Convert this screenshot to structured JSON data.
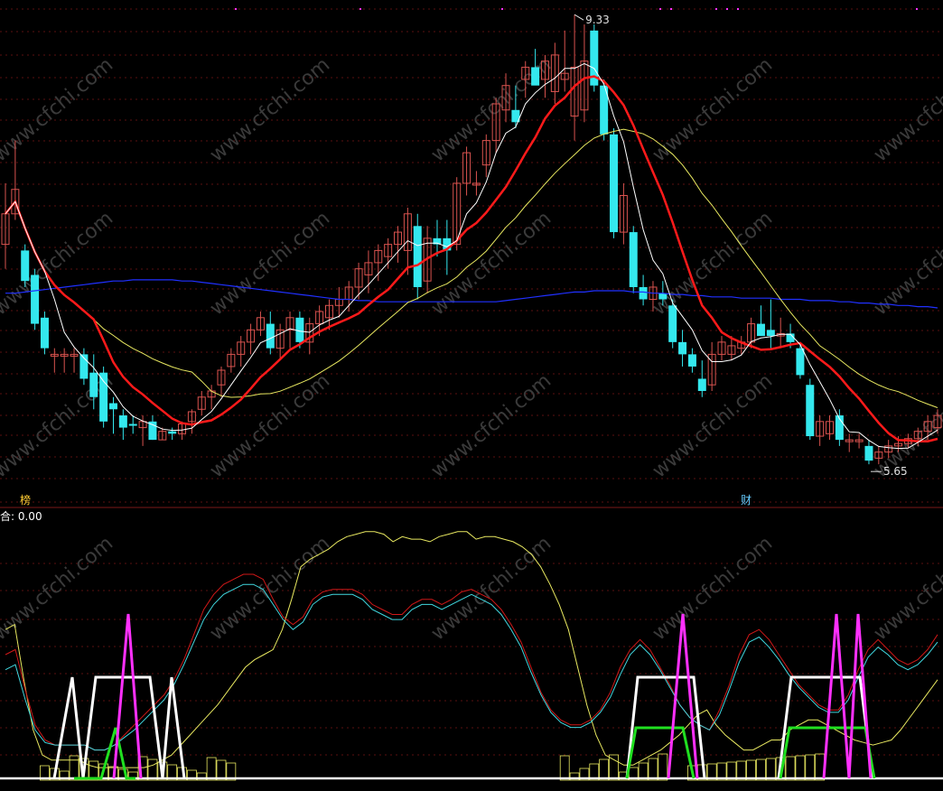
{
  "colors": {
    "background": "#000000",
    "grid": "#5a1010",
    "up": "#d9534f",
    "down": "#34e8ee",
    "ma5": "#ffffff",
    "ma10": "#ff1a1a",
    "ma20": "#e8e860",
    "ma60": "#2030ff",
    "ind_yellow": "#e8e860",
    "ind_red": "#d01818",
    "ind_cyan": "#40d8e0",
    "sig_white": "#ffffff",
    "sig_green": "#20e020",
    "sig_magenta": "#ff30ff",
    "bottom_bars": "#e8e860",
    "price_label": "#e0e0e0"
  },
  "watermark": "www.cfchi.com",
  "chart_data": {
    "type": "candlestick",
    "price_high_label": "9.33",
    "price_low_label": "5.65",
    "annotation_left": "榜",
    "annotation_right": "财",
    "indicator_header": "合: 0.00",
    "ylim": [
      5.4,
      9.45
    ],
    "candles": [
      {
        "o": 7.45,
        "h": 7.95,
        "l": 7.25,
        "c": 7.7
      },
      {
        "o": 7.7,
        "h": 8.3,
        "l": 7.65,
        "c": 7.9
      },
      {
        "o": 7.4,
        "h": 7.45,
        "l": 7.1,
        "c": 7.15
      },
      {
        "o": 7.2,
        "h": 7.25,
        "l": 6.75,
        "c": 6.8
      },
      {
        "o": 6.85,
        "h": 6.9,
        "l": 6.55,
        "c": 6.6
      },
      {
        "o": 6.55,
        "h": 6.6,
        "l": 6.4,
        "c": 6.55
      },
      {
        "o": 6.55,
        "h": 6.6,
        "l": 6.4,
        "c": 6.55
      },
      {
        "o": 6.55,
        "h": 6.6,
        "l": 6.4,
        "c": 6.55
      },
      {
        "o": 6.55,
        "h": 6.6,
        "l": 6.3,
        "c": 6.35
      },
      {
        "o": 6.4,
        "h": 6.55,
        "l": 6.1,
        "c": 6.2
      },
      {
        "o": 6.4,
        "h": 6.45,
        "l": 5.95,
        "c": 6.0
      },
      {
        "o": 6.15,
        "h": 6.2,
        "l": 5.9,
        "c": 6.1
      },
      {
        "o": 6.05,
        "h": 6.1,
        "l": 5.85,
        "c": 5.95
      },
      {
        "o": 5.98,
        "h": 6.05,
        "l": 5.9,
        "c": 5.97
      },
      {
        "o": 5.95,
        "h": 6.05,
        "l": 5.8,
        "c": 6.0
      },
      {
        "o": 6.0,
        "h": 6.05,
        "l": 5.85,
        "c": 5.85
      },
      {
        "o": 5.85,
        "h": 5.95,
        "l": 5.85,
        "c": 5.92
      },
      {
        "o": 5.92,
        "h": 5.95,
        "l": 5.85,
        "c": 5.9
      },
      {
        "o": 5.9,
        "h": 6.0,
        "l": 5.85,
        "c": 5.98
      },
      {
        "o": 6.0,
        "h": 6.1,
        "l": 5.9,
        "c": 6.08
      },
      {
        "o": 6.1,
        "h": 6.25,
        "l": 6.05,
        "c": 6.2
      },
      {
        "o": 6.2,
        "h": 6.3,
        "l": 6.1,
        "c": 6.25
      },
      {
        "o": 6.3,
        "h": 6.45,
        "l": 6.2,
        "c": 6.42
      },
      {
        "o": 6.45,
        "h": 6.6,
        "l": 6.4,
        "c": 6.55
      },
      {
        "o": 6.55,
        "h": 6.7,
        "l": 6.45,
        "c": 6.65
      },
      {
        "o": 6.65,
        "h": 6.8,
        "l": 6.55,
        "c": 6.75
      },
      {
        "o": 6.75,
        "h": 6.9,
        "l": 6.7,
        "c": 6.85
      },
      {
        "o": 6.8,
        "h": 6.9,
        "l": 6.55,
        "c": 6.6
      },
      {
        "o": 6.6,
        "h": 6.8,
        "l": 6.5,
        "c": 6.75
      },
      {
        "o": 6.75,
        "h": 6.9,
        "l": 6.6,
        "c": 6.85
      },
      {
        "o": 6.85,
        "h": 6.9,
        "l": 6.6,
        "c": 6.65
      },
      {
        "o": 6.65,
        "h": 6.85,
        "l": 6.55,
        "c": 6.8
      },
      {
        "o": 6.8,
        "h": 6.95,
        "l": 6.7,
        "c": 6.9
      },
      {
        "o": 6.85,
        "h": 7.0,
        "l": 6.75,
        "c": 6.95
      },
      {
        "o": 6.95,
        "h": 7.1,
        "l": 6.85,
        "c": 7.0
      },
      {
        "o": 7.0,
        "h": 7.15,
        "l": 6.9,
        "c": 7.1
      },
      {
        "o": 7.1,
        "h": 7.3,
        "l": 7.0,
        "c": 7.25
      },
      {
        "o": 7.2,
        "h": 7.4,
        "l": 7.05,
        "c": 7.3
      },
      {
        "o": 7.3,
        "h": 7.45,
        "l": 7.15,
        "c": 7.4
      },
      {
        "o": 7.35,
        "h": 7.5,
        "l": 7.25,
        "c": 7.45
      },
      {
        "o": 7.45,
        "h": 7.6,
        "l": 7.3,
        "c": 7.55
      },
      {
        "o": 7.4,
        "h": 7.75,
        "l": 7.2,
        "c": 7.7
      },
      {
        "o": 7.6,
        "h": 7.7,
        "l": 7.0,
        "c": 7.1
      },
      {
        "o": 7.15,
        "h": 7.6,
        "l": 7.05,
        "c": 7.5
      },
      {
        "o": 7.5,
        "h": 7.65,
        "l": 7.35,
        "c": 7.45
      },
      {
        "o": 7.5,
        "h": 7.65,
        "l": 7.2,
        "c": 7.4
      },
      {
        "o": 7.45,
        "h": 8.0,
        "l": 7.4,
        "c": 7.95
      },
      {
        "o": 7.95,
        "h": 8.25,
        "l": 7.85,
        "c": 8.2
      },
      {
        "o": 7.95,
        "h": 8.05,
        "l": 7.85,
        "c": 7.95
      },
      {
        "o": 8.1,
        "h": 8.35,
        "l": 8.0,
        "c": 8.3
      },
      {
        "o": 8.3,
        "h": 8.65,
        "l": 8.2,
        "c": 8.6
      },
      {
        "o": 8.55,
        "h": 8.85,
        "l": 8.45,
        "c": 8.75
      },
      {
        "o": 8.55,
        "h": 8.75,
        "l": 8.4,
        "c": 8.45
      },
      {
        "o": 8.8,
        "h": 8.95,
        "l": 8.65,
        "c": 8.9
      },
      {
        "o": 8.9,
        "h": 9.05,
        "l": 8.8,
        "c": 8.75
      },
      {
        "o": 8.8,
        "h": 9.0,
        "l": 8.65,
        "c": 8.95
      },
      {
        "o": 8.7,
        "h": 9.1,
        "l": 8.6,
        "c": 9.0
      },
      {
        "o": 8.8,
        "h": 9.2,
        "l": 8.7,
        "c": 8.85
      },
      {
        "o": 8.5,
        "h": 9.33,
        "l": 8.3,
        "c": 8.9
      },
      {
        "o": 8.55,
        "h": 9.25,
        "l": 8.45,
        "c": 8.95
      },
      {
        "o": 9.2,
        "h": 9.25,
        "l": 8.7,
        "c": 8.75
      },
      {
        "o": 8.75,
        "h": 8.8,
        "l": 8.3,
        "c": 8.35
      },
      {
        "o": 8.35,
        "h": 8.4,
        "l": 7.5,
        "c": 7.55
      },
      {
        "o": 7.55,
        "h": 7.95,
        "l": 7.45,
        "c": 7.85
      },
      {
        "o": 7.55,
        "h": 7.6,
        "l": 7.05,
        "c": 7.1
      },
      {
        "o": 7.1,
        "h": 7.2,
        "l": 6.95,
        "c": 7.0
      },
      {
        "o": 7.0,
        "h": 7.15,
        "l": 6.9,
        "c": 7.1
      },
      {
        "o": 7.05,
        "h": 7.15,
        "l": 6.95,
        "c": 7.0
      },
      {
        "o": 6.95,
        "h": 7.0,
        "l": 6.6,
        "c": 6.65
      },
      {
        "o": 6.65,
        "h": 6.75,
        "l": 6.45,
        "c": 6.55
      },
      {
        "o": 6.55,
        "h": 6.6,
        "l": 6.4,
        "c": 6.45
      },
      {
        "o": 6.35,
        "h": 6.5,
        "l": 6.2,
        "c": 6.25
      },
      {
        "o": 6.3,
        "h": 6.65,
        "l": 6.25,
        "c": 6.55
      },
      {
        "o": 6.55,
        "h": 6.7,
        "l": 6.5,
        "c": 6.65
      },
      {
        "o": 6.55,
        "h": 6.7,
        "l": 6.5,
        "c": 6.62
      },
      {
        "o": 6.6,
        "h": 6.7,
        "l": 6.55,
        "c": 6.65
      },
      {
        "o": 6.65,
        "h": 6.85,
        "l": 6.6,
        "c": 6.8
      },
      {
        "o": 6.8,
        "h": 6.95,
        "l": 6.7,
        "c": 6.7
      },
      {
        "o": 6.75,
        "h": 7.0,
        "l": 6.6,
        "c": 6.7
      },
      {
        "o": 6.7,
        "h": 6.85,
        "l": 6.6,
        "c": 6.72
      },
      {
        "o": 6.72,
        "h": 6.8,
        "l": 6.6,
        "c": 6.65
      },
      {
        "o": 6.6,
        "h": 6.65,
        "l": 6.35,
        "c": 6.38
      },
      {
        "o": 6.3,
        "h": 6.35,
        "l": 5.85,
        "c": 5.88
      },
      {
        "o": 5.88,
        "h": 6.05,
        "l": 5.8,
        "c": 6.0
      },
      {
        "o": 5.9,
        "h": 6.05,
        "l": 5.85,
        "c": 6.0
      },
      {
        "o": 6.05,
        "h": 6.1,
        "l": 5.8,
        "c": 5.85
      },
      {
        "o": 5.85,
        "h": 5.9,
        "l": 5.75,
        "c": 5.85
      },
      {
        "o": 5.85,
        "h": 5.9,
        "l": 5.78,
        "c": 5.85
      },
      {
        "o": 5.8,
        "h": 5.85,
        "l": 5.65,
        "c": 5.68
      },
      {
        "o": 5.7,
        "h": 5.8,
        "l": 5.65,
        "c": 5.75
      },
      {
        "o": 5.75,
        "h": 5.85,
        "l": 5.7,
        "c": 5.8
      },
      {
        "o": 5.8,
        "h": 5.88,
        "l": 5.75,
        "c": 5.82
      },
      {
        "o": 5.82,
        "h": 5.9,
        "l": 5.78,
        "c": 5.86
      },
      {
        "o": 5.86,
        "h": 5.95,
        "l": 5.8,
        "c": 5.92
      },
      {
        "o": 5.92,
        "h": 6.05,
        "l": 5.85,
        "c": 6.0
      },
      {
        "o": 5.95,
        "h": 6.1,
        "l": 5.9,
        "c": 6.05
      }
    ],
    "ma60": [
      7.05,
      7.05,
      7.06,
      7.07,
      7.08,
      7.09,
      7.1,
      7.11,
      7.12,
      7.13,
      7.14,
      7.15,
      7.15,
      7.16,
      7.16,
      7.16,
      7.16,
      7.16,
      7.15,
      7.15,
      7.14,
      7.13,
      7.12,
      7.11,
      7.1,
      7.09,
      7.08,
      7.07,
      7.06,
      7.05,
      7.04,
      7.03,
      7.02,
      7.01,
      7.0,
      7.0,
      6.99,
      6.99,
      6.98,
      6.98,
      6.98,
      6.98,
      6.98,
      6.98,
      6.98,
      6.98,
      6.98,
      6.98,
      6.98,
      6.98,
      6.98,
      6.99,
      7.0,
      7.01,
      7.02,
      7.03,
      7.04,
      7.05,
      7.06,
      7.06,
      7.07,
      7.07,
      7.07,
      7.07,
      7.06,
      7.06,
      7.05,
      7.05,
      7.04,
      7.04,
      7.03,
      7.03,
      7.02,
      7.02,
      7.02,
      7.01,
      7.01,
      7.01,
      7.01,
      7.0,
      7.0,
      7.0,
      6.99,
      6.99,
      6.99,
      6.98,
      6.98,
      6.97,
      6.97,
      6.96,
      6.96,
      6.95,
      6.95,
      6.94,
      6.94,
      6.93
    ],
    "indicator": {
      "ylim": [
        0,
        100
      ],
      "yellow": [
        60,
        62,
        40,
        20,
        10,
        8,
        8,
        8,
        8,
        6,
        5,
        5,
        5,
        5,
        5,
        5,
        6,
        8,
        10,
        14,
        18,
        22,
        26,
        30,
        35,
        40,
        45,
        48,
        50,
        52,
        60,
        72,
        85,
        88,
        90,
        92,
        95,
        97,
        98,
        99,
        99,
        98,
        95,
        97,
        96,
        96,
        95,
        97,
        98,
        99,
        99,
        96,
        97,
        97,
        96,
        95,
        93,
        90,
        85,
        78,
        70,
        60,
        45,
        30,
        18,
        10,
        8,
        6,
        6,
        8,
        10,
        12,
        15,
        18,
        22,
        26,
        28,
        22,
        18,
        15,
        12,
        12,
        14,
        16,
        16,
        20,
        22,
        24,
        24,
        22,
        20,
        18,
        16,
        15,
        14,
        15,
        16,
        20,
        25,
        30,
        35,
        40
      ],
      "red": [
        50,
        52,
        36,
        22,
        16,
        14,
        14,
        14,
        14,
        12,
        12,
        14,
        18,
        22,
        26,
        30,
        34,
        40,
        48,
        58,
        68,
        74,
        78,
        80,
        82,
        82,
        80,
        72,
        65,
        62,
        65,
        72,
        75,
        76,
        76,
        76,
        74,
        70,
        68,
        66,
        66,
        70,
        72,
        72,
        70,
        72,
        75,
        76,
        74,
        72,
        68,
        62,
        55,
        45,
        35,
        28,
        24,
        22,
        22,
        24,
        28,
        35,
        45,
        52,
        56,
        52,
        45,
        38,
        30,
        25,
        22,
        20,
        28,
        38,
        50,
        58,
        60,
        56,
        50,
        44,
        38,
        34,
        30,
        28,
        28,
        34,
        44,
        52,
        56,
        52,
        48,
        46,
        48,
        52,
        58
      ],
      "cyan": [
        44,
        46,
        32,
        20,
        15,
        14,
        14,
        14,
        14,
        12,
        12,
        14,
        17,
        20,
        24,
        28,
        32,
        38,
        46,
        55,
        64,
        70,
        74,
        76,
        78,
        78,
        76,
        70,
        64,
        60,
        63,
        70,
        73,
        74,
        74,
        74,
        72,
        68,
        66,
        64,
        64,
        68,
        70,
        70,
        68,
        70,
        72,
        74,
        72,
        70,
        66,
        60,
        53,
        43,
        34,
        27,
        23,
        21,
        21,
        23,
        27,
        33,
        42,
        50,
        54,
        50,
        44,
        37,
        30,
        25,
        22,
        20,
        26,
        36,
        47,
        55,
        57,
        53,
        48,
        42,
        37,
        33,
        29,
        27,
        27,
        32,
        41,
        49,
        53,
        50,
        46,
        44,
        46,
        50,
        55
      ]
    }
  }
}
